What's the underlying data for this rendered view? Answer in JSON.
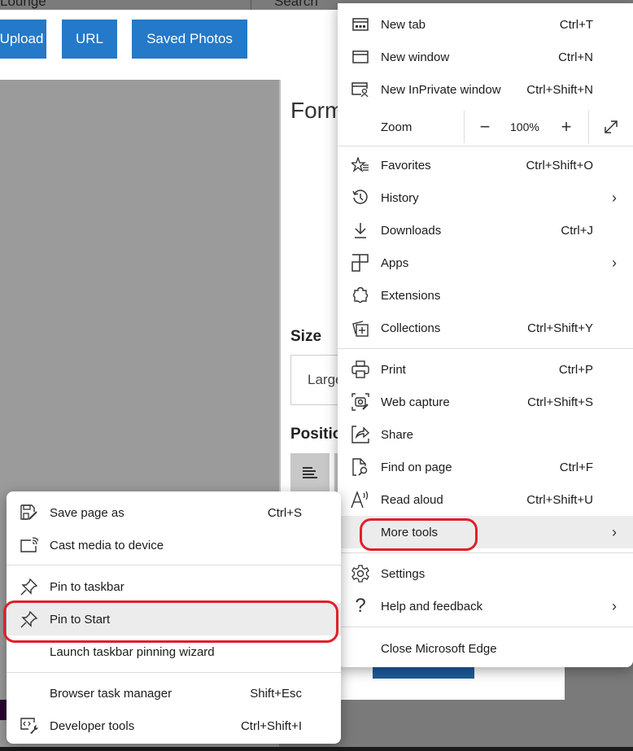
{
  "page": {
    "top_tabs": [
      "Lounge",
      "Search"
    ],
    "buttons": [
      "Upload",
      "URL",
      "Saved Photos"
    ],
    "format_panel": {
      "title": "Format",
      "size_label": "Size",
      "size_value": "Large",
      "position_label": "Position"
    }
  },
  "main_menu": {
    "items_top": [
      {
        "icon": "new-tab-icon",
        "label": "New tab",
        "shortcut": "Ctrl+T"
      },
      {
        "icon": "new-window-icon",
        "label": "New window",
        "shortcut": "Ctrl+N"
      },
      {
        "icon": "inprivate-icon",
        "label": "New InPrivate window",
        "shortcut": "Ctrl+Shift+N"
      }
    ],
    "zoom": {
      "label": "Zoom",
      "minus": "−",
      "value": "100%",
      "plus": "+"
    },
    "items_mid": [
      {
        "icon": "favorites-icon",
        "label": "Favorites",
        "shortcut": "Ctrl+Shift+O"
      },
      {
        "icon": "history-icon",
        "label": "History",
        "shortcut": "",
        "submenu": true
      },
      {
        "icon": "downloads-icon",
        "label": "Downloads",
        "shortcut": "Ctrl+J"
      },
      {
        "icon": "apps-icon",
        "label": "Apps",
        "shortcut": "",
        "submenu": true
      },
      {
        "icon": "extensions-icon",
        "label": "Extensions",
        "shortcut": ""
      },
      {
        "icon": "collections-icon",
        "label": "Collections",
        "shortcut": "Ctrl+Shift+Y"
      }
    ],
    "items_tools": [
      {
        "icon": "print-icon",
        "label": "Print",
        "shortcut": "Ctrl+P"
      },
      {
        "icon": "web-capture-icon",
        "label": "Web capture",
        "shortcut": "Ctrl+Shift+S"
      },
      {
        "icon": "share-icon",
        "label": "Share",
        "shortcut": ""
      },
      {
        "icon": "find-icon",
        "label": "Find on page",
        "shortcut": "Ctrl+F"
      },
      {
        "icon": "read-aloud-icon",
        "label": "Read aloud",
        "shortcut": "Ctrl+Shift+U"
      },
      {
        "icon": "",
        "label": "More tools",
        "shortcut": "",
        "submenu": true,
        "highlighted": true
      }
    ],
    "items_settings": [
      {
        "icon": "settings-icon",
        "label": "Settings",
        "shortcut": ""
      },
      {
        "icon": "help-icon",
        "label": "Help and feedback",
        "shortcut": "",
        "submenu": true
      }
    ],
    "close": {
      "label": "Close Microsoft Edge"
    }
  },
  "sub_menu": {
    "group1": [
      {
        "icon": "save-page-icon",
        "label": "Save page as",
        "shortcut": "Ctrl+S"
      },
      {
        "icon": "cast-icon",
        "label": "Cast media to device",
        "shortcut": ""
      }
    ],
    "group2": [
      {
        "icon": "pin-icon",
        "label": "Pin to taskbar",
        "shortcut": ""
      },
      {
        "icon": "pin-icon",
        "label": "Pin to Start",
        "shortcut": "",
        "highlighted": true
      },
      {
        "icon": "",
        "label": "Launch taskbar pinning wizard",
        "shortcut": ""
      }
    ],
    "group3": [
      {
        "icon": "",
        "label": "Browser task manager",
        "shortcut": "Shift+Esc"
      },
      {
        "icon": "developer-tools-icon",
        "label": "Developer tools",
        "shortcut": "Ctrl+Shift+I"
      }
    ]
  },
  "colors": {
    "button_blue": "#2479c9",
    "highlight_ring": "#e0202a",
    "hover_bg": "#ececec"
  }
}
